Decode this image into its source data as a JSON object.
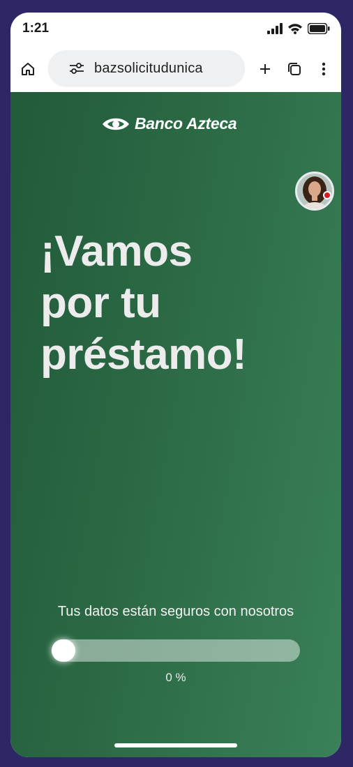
{
  "status_bar": {
    "time": "1:21",
    "icons": [
      "signal-icon",
      "wifi-icon",
      "battery-icon"
    ]
  },
  "browser": {
    "url": "bazsolicitudunica",
    "buttons": [
      "home-icon",
      "site-settings-icon",
      "new-tab-icon",
      "tabs-icon",
      "more-icon"
    ]
  },
  "page": {
    "logo_text": "Banco Azteca",
    "headline": [
      "¡Vamos",
      "por tu",
      "préstamo!"
    ],
    "secure_message": "Tus datos están seguros con nosotros",
    "progress": {
      "percent": 0,
      "label": "0 %"
    }
  },
  "colors": {
    "background": "#2d2766",
    "brand_green": "#2b6a45",
    "notification_red": "#d01e2b"
  }
}
